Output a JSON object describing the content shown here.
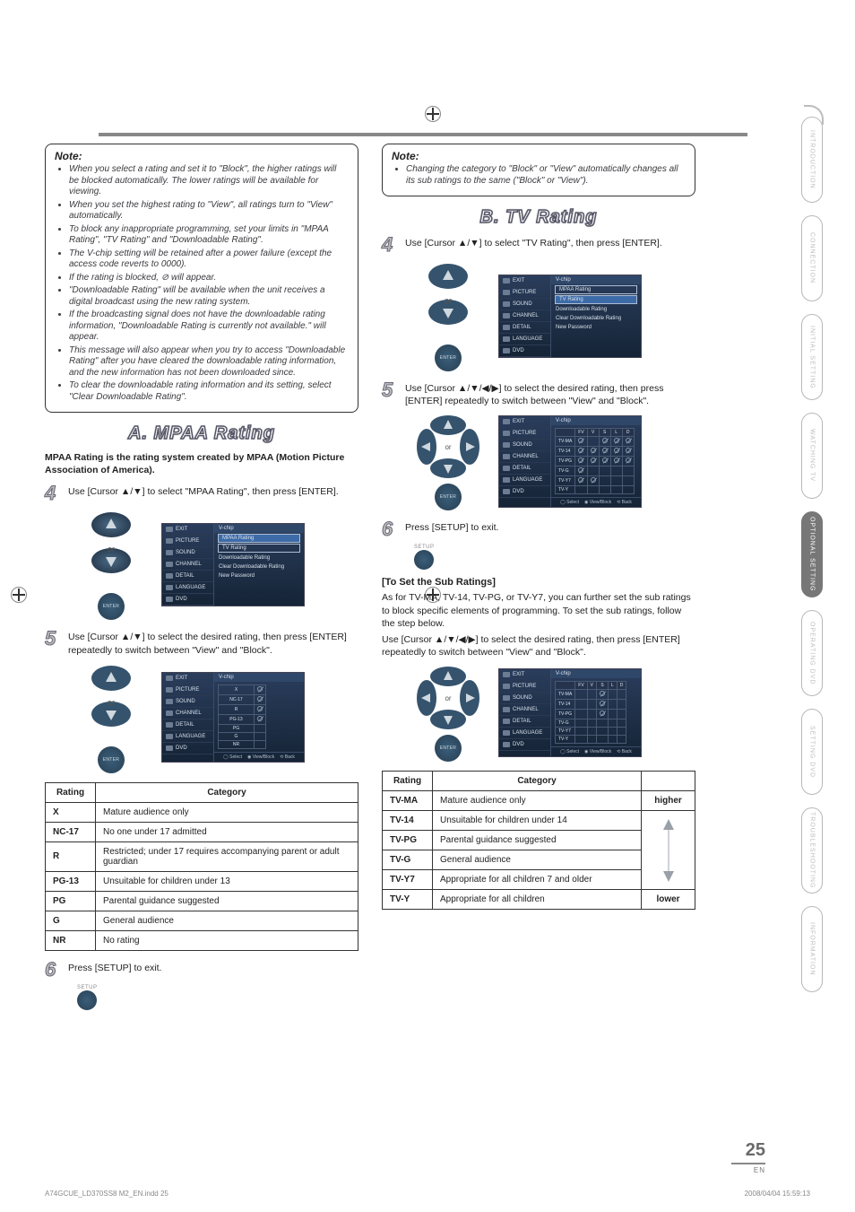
{
  "page_number": "25",
  "page_en": "EN",
  "footer_left": "A74GCUE_LD370SS8 M2_EN.indd   25",
  "footer_right": "2008/04/04   15:59:13",
  "side_tabs": [
    "INTRODUCTION",
    "CONNECTION",
    "INITIAL SETTING",
    "WATCHING TV",
    "OPTIONAL SETTING",
    "OPERATING DVD",
    "SETTING DVD",
    "TROUBLESHOOTING",
    "INFORMATION"
  ],
  "section_a_title": "A.  MPAA Rating",
  "section_b_title": "B.  TV Rating",
  "noteA": {
    "title": "Note:",
    "items": [
      "When you select a rating and set it to \"Block\", the higher ratings will be blocked automatically. The lower ratings will be available for viewing.",
      "When you set the highest rating to \"View\", all ratings turn to \"View\" automatically.",
      "To block any inappropriate programming, set your limits in \"MPAA Rating\", \"TV Rating\" and \"Downloadable Rating\".",
      "The V-chip setting will be retained after a power failure (except the access code reverts to 0000).",
      "If the rating is blocked, ⊘ will appear.",
      "\"Downloadable Rating\" will be available when the unit receives a digital broadcast using the new rating system.",
      "If the broadcasting signal does not have the downloadable rating information, \"Downloadable Rating is currently not available.\" will appear.",
      "This message will also appear when you try to access \"Downloadable Rating\" after you have cleared the downloadable rating information, and the new information has not been downloaded since.",
      "To clear the downloadable rating information and its setting, select \"Clear Downloadable Rating\"."
    ]
  },
  "noteB": {
    "title": "Note:",
    "items": [
      "Changing the category to \"Block\" or \"View\" automatically changes all its sub ratings to the same (\"Block\" or \"View\")."
    ]
  },
  "mpaa_intro": "MPAA Rating is the rating system created by MPAA (Motion Picture Association of America).",
  "steps": {
    "a4": "Use [Cursor ▲/▼] to select \"MPAA Rating\", then press [ENTER].",
    "a5": "Use [Cursor ▲/▼] to select the desired rating, then press [ENTER] repeatedly to switch between \"View\" and \"Block\".",
    "a6": "Press [SETUP] to exit.",
    "b4": "Use [Cursor ▲/▼] to select \"TV Rating\", then press [ENTER].",
    "b5": "Use [Cursor ▲/▼/◀/▶] to select the desired rating, then press [ENTER] repeatedly to switch between \"View\" and \"Block\".",
    "b6": "Press [SETUP] to exit."
  },
  "subratings": {
    "head": "[To Set the Sub Ratings]",
    "para1": "As for TV-MA, TV-14, TV-PG, or TV-Y7, you can further set the sub ratings to block specific elements of programming. To set the sub ratings, follow the step below.",
    "para2": "Use [Cursor ▲/▼/◀/▶] to select the desired rating, then press [ENTER] repeatedly to switch between \"View\" and \"Block\"."
  },
  "or": "or",
  "enter": "ENTER",
  "setup": "SETUP",
  "osd_menu": {
    "title": "V-chip",
    "left": [
      "EXIT",
      "PICTURE",
      "SOUND",
      "CHANNEL",
      "DETAIL",
      "LANGUAGE",
      "DVD"
    ],
    "items": [
      "MPAA Rating",
      "TV Rating",
      "Downloadable Rating",
      "Clear Downloadable Rating",
      "New Password"
    ],
    "foot_select": "Select",
    "foot_vb": "View/Block",
    "foot_back": "Back"
  },
  "osd_mpaa_list": [
    "X",
    "NC-17",
    "R",
    "PG-13",
    "PG",
    "G",
    "NR"
  ],
  "osd_tv_cols": [
    "FV",
    "V",
    "S",
    "L",
    "D"
  ],
  "osd_tv_rows": [
    "TV-MA",
    "TV-14",
    "TV-PG",
    "TV-G",
    "TV-Y7",
    "TV-Y"
  ],
  "mpaa_table": {
    "head": [
      "Rating",
      "Category"
    ],
    "rows": [
      [
        "X",
        "Mature audience only"
      ],
      [
        "NC-17",
        "No one under 17 admitted"
      ],
      [
        "R",
        "Restricted; under 17 requires accompanying parent or adult guardian"
      ],
      [
        "PG-13",
        "Unsuitable for children under 13"
      ],
      [
        "PG",
        "Parental guidance suggested"
      ],
      [
        "G",
        "General audience"
      ],
      [
        "NR",
        "No rating"
      ]
    ]
  },
  "tv_table": {
    "head": [
      "Rating",
      "Category",
      ""
    ],
    "higher": "higher",
    "lower": "lower",
    "rows": [
      [
        "TV-MA",
        "Mature audience only"
      ],
      [
        "TV-14",
        "Unsuitable for children under 14"
      ],
      [
        "TV-PG",
        "Parental guidance suggested"
      ],
      [
        "TV-G",
        "General audience"
      ],
      [
        "TV-Y7",
        "Appropriate for all children 7 and older"
      ],
      [
        "TV-Y",
        "Appropriate for all children"
      ]
    ]
  }
}
